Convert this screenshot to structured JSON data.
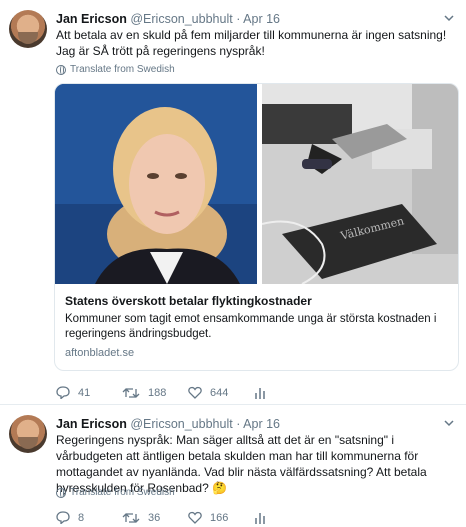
{
  "tweets": [
    {
      "author_name": "Jan Ericson",
      "handle": "@Ericson_ubbhult",
      "dot": "·",
      "date": "Apr 16",
      "text": "Att betala av en skuld på fem miljarder till kommunerna är ingen satsning! Jag är SÅ trött på regeringens nyspråk!",
      "translate_label": "Translate from Swedish",
      "card": {
        "title": "Statens överskott betalar flyktingkostnader",
        "description": "Kommuner som tagit emot ensamkommande unga är största kostnaden i regeringens ändringsbudget.",
        "domain": "aftonbladet.se",
        "doormat_text": "Välkommen"
      },
      "replies": "41",
      "retweets": "188",
      "likes": "644"
    },
    {
      "author_name": "Jan Ericson",
      "handle": "@Ericson_ubbhult",
      "dot": "·",
      "date": "Apr 16",
      "text": "Regeringens nyspråk: Man säger alltså att det är en \"satsning\" i vårbudgeten att äntligen betala skulden man har till kommunerna för mottagandet av nyanlända. Vad blir nästa välfärdssatsning? Att betala hyresskulden för Rosenbad? 🤔",
      "translate_label": "Translate from Swedish",
      "replies": "8",
      "retweets": "36",
      "likes": "166"
    }
  ],
  "icons": {
    "reply": "reply-icon",
    "retweet": "retweet-icon",
    "like": "heart-icon",
    "analytics": "analytics-icon",
    "menu": "chevron-down-icon",
    "translate": "globe-icon"
  },
  "colors": {
    "text": "#14171a",
    "secondary": "#657786",
    "border": "#e1e8ed"
  }
}
